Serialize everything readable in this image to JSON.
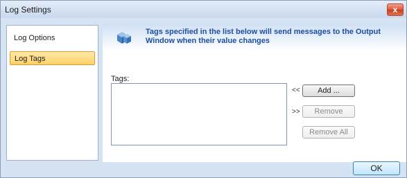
{
  "window": {
    "title": "Log Settings",
    "close_label": "x"
  },
  "sidebar": {
    "items": [
      {
        "label": "Log Options",
        "selected": false
      },
      {
        "label": "Log Tags",
        "selected": true
      }
    ]
  },
  "banner": {
    "text": "Tags specified in the list below will send messages to the Output Window when their value changes"
  },
  "tags": {
    "label": "Tags:",
    "items": []
  },
  "actions": {
    "add_arrow": "<<",
    "add_label": "Add ...",
    "remove_arrow": ">>",
    "remove_label": "Remove",
    "remove_all_label": "Remove All"
  },
  "footer": {
    "ok_label": "OK"
  },
  "colors": {
    "accent": "#1f4fa0",
    "selected_bg": "#ffd266",
    "frame": "#d6e3f3"
  }
}
